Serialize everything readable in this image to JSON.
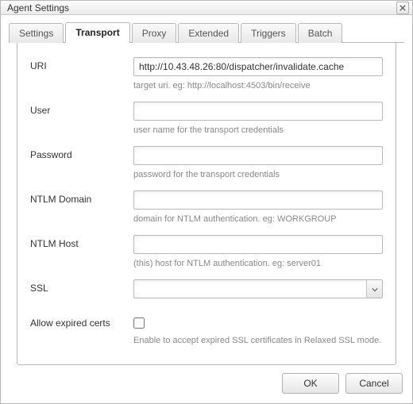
{
  "title": "Agent Settings",
  "tabs": {
    "settings": "Settings",
    "transport": "Transport",
    "proxy": "Proxy",
    "extended": "Extended",
    "triggers": "Triggers",
    "batch": "Batch",
    "active": "transport"
  },
  "fields": {
    "uri": {
      "label": "URI",
      "value": "http://10.43.48.26:80/dispatcher/invalidate.cache",
      "hint": "target uri. eg: http://localhost:4503/bin/receive"
    },
    "user": {
      "label": "User",
      "value": "",
      "hint": "user name for the transport credentials"
    },
    "password": {
      "label": "Password",
      "value": "",
      "hint": "password for the transport credentials"
    },
    "ntlm_domain": {
      "label": "NTLM Domain",
      "value": "",
      "hint": "domain for NTLM authentication. eg: WORKGROUP"
    },
    "ntlm_host": {
      "label": "NTLM Host",
      "value": "",
      "hint": "(this) host for NTLM authentication. eg: server01"
    },
    "ssl": {
      "label": "SSL",
      "value": ""
    },
    "allow_expired": {
      "label": "Allow expired certs",
      "checked": false,
      "hint": "Enable to accept expired SSL certificates in Relaxed SSL mode."
    }
  },
  "buttons": {
    "ok": "OK",
    "cancel": "Cancel"
  }
}
